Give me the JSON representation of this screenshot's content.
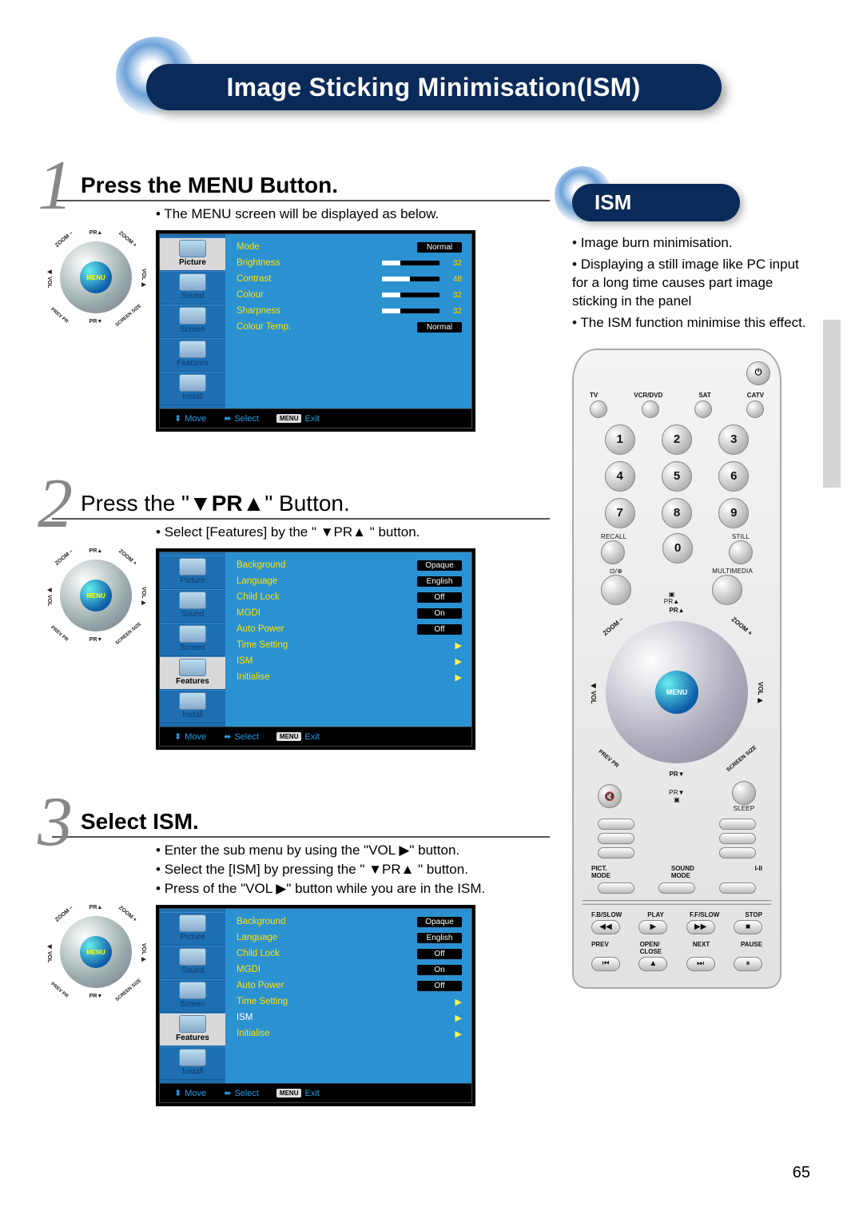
{
  "page_number": "65",
  "banner_title": "Image Sticking Minimisation(ISM)",
  "dpad": {
    "center": "MENU",
    "pr_up_sq": "▣",
    "pr_up": "PR▲",
    "pr_dn": "PR▼",
    "pr_dn_sq": "▣",
    "vol_l": "◀ VOL",
    "vol_r": "VOL ▶",
    "zoom_minus": "ZOOM −",
    "zoom_plus": "ZOOM +",
    "prev_pr": "PREV PR",
    "screen_size": "SCREEN SIZE"
  },
  "osd_tabs": [
    "Picture",
    "Sound",
    "Screen",
    "Features",
    "Install"
  ],
  "osd_hints": {
    "move": "Move",
    "select": "Select",
    "menu": "MENU",
    "exit": "Exit"
  },
  "steps": [
    {
      "num": "1",
      "title_bold": "Press the MENU Button.",
      "title_light": "",
      "notes": [
        "The MENU screen will be displayed as below."
      ],
      "active_tab": "Picture",
      "menu": [
        {
          "k": "Mode",
          "vbox": "Normal"
        },
        {
          "k": "Brightness",
          "bar": 32,
          "num": "32"
        },
        {
          "k": "Contrast",
          "bar": 48,
          "num": "48"
        },
        {
          "k": "Colour",
          "bar": 32,
          "num": "32"
        },
        {
          "k": "Sharpness",
          "bar": 32,
          "num": "32"
        },
        {
          "k": "Colour Temp.",
          "vbox": "Normal"
        }
      ]
    },
    {
      "num": "2",
      "title_bold": "",
      "title_pre": "Press the \"",
      "title_mid": "▼PR▲",
      "title_post": "\" Button.",
      "notes": [
        "Select [Features] by the \" ▼PR▲ \" button."
      ],
      "active_tab": "Features",
      "menu": [
        {
          "k": "Background",
          "vbox": "Opaque"
        },
        {
          "k": "Language",
          "vbox": "English"
        },
        {
          "k": "Child Lock",
          "vbox": "Off"
        },
        {
          "k": "MGDI",
          "vbox": "On"
        },
        {
          "k": "Auto Power",
          "vbox": "Off"
        },
        {
          "k": "Time Setting",
          "tri": true
        },
        {
          "k": "ISM",
          "tri": true
        },
        {
          "k": "Initialise",
          "tri": true
        }
      ]
    },
    {
      "num": "3",
      "title_bold": "Select ISM.",
      "notes": [
        "Enter the sub menu by using the \"VOL ▶\" button.",
        "Select the [ISM] by pressing the \" ▼PR▲ \" button.",
        "Press of the \"VOL ▶\" button while you are in the ISM."
      ],
      "active_tab": "Features",
      "highlight": "ISM",
      "menu": [
        {
          "k": "Background",
          "vbox": "Opaque"
        },
        {
          "k": "Language",
          "vbox": "English"
        },
        {
          "k": "Child Lock",
          "vbox": "Off"
        },
        {
          "k": "MGDI",
          "vbox": "On"
        },
        {
          "k": "Auto Power",
          "vbox": "Off"
        },
        {
          "k": "Time Setting",
          "tri": true
        },
        {
          "k": "ISM",
          "tri": true,
          "hi": true
        },
        {
          "k": "Initialise",
          "tri": true
        }
      ]
    }
  ],
  "ism": {
    "title": "ISM",
    "bullets": [
      "Image burn minimisation.",
      "Displaying a still image like PC input for a long time causes part image sticking in the panel",
      "The ISM function minimise this effect."
    ]
  },
  "remote": {
    "power_icon": "⏻",
    "modes": [
      "TV",
      "VCR/DVD",
      "SAT",
      "CATV"
    ],
    "numbers": [
      "1",
      "2",
      "3",
      "4",
      "5",
      "6",
      "7",
      "8",
      "9",
      "0"
    ],
    "recall": "RECALL",
    "still": "STILL",
    "av": "⊡/⊕",
    "multimedia": "MULTIMEDIA",
    "sq": "▣",
    "pr_up": "PR▲",
    "mute": "🔇",
    "sleep": "SLEEP",
    "pict_mode": "PICT.\nMODE",
    "sound_mode": "SOUND\nMODE",
    "i_ii": "I-II",
    "transport_top": [
      "F.B/SLOW",
      "PLAY",
      "F.F/SLOW",
      "STOP"
    ],
    "transport_top_sym": [
      "◀◀",
      "▶",
      "▶▶",
      "■"
    ],
    "transport_bot": [
      "PREV",
      "OPEN/\nCLOSE",
      "NEXT",
      "PAUSE"
    ],
    "transport_bot_sym": [
      "⏮",
      "▲",
      "⏭",
      "⏸"
    ]
  }
}
